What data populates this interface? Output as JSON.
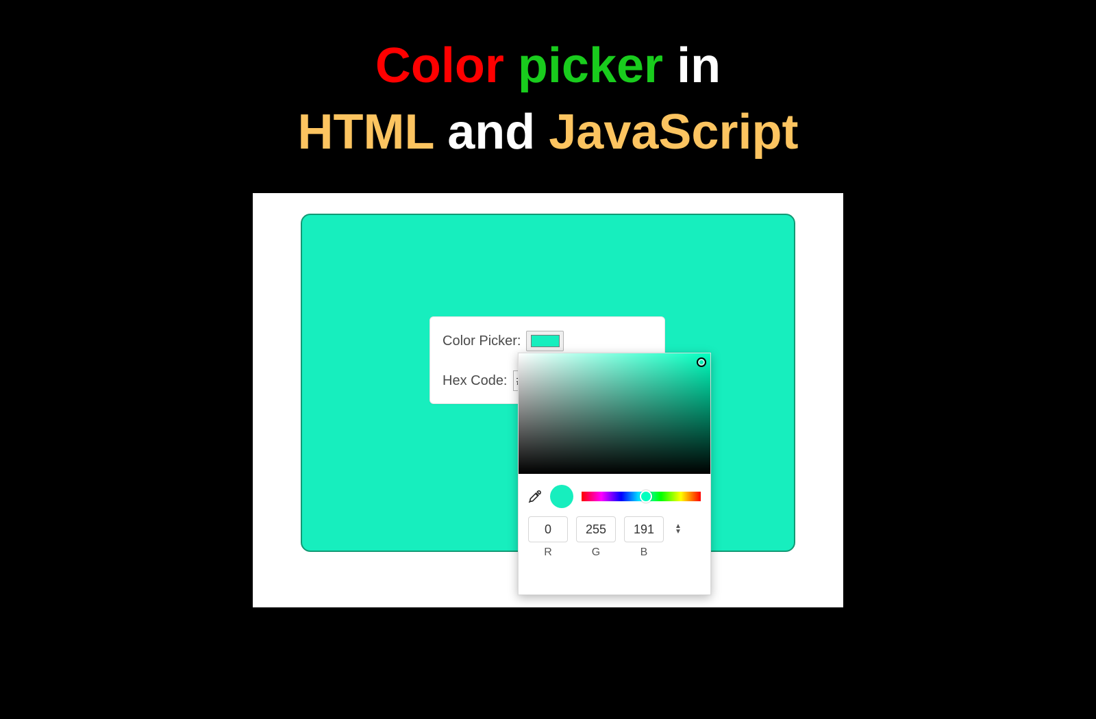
{
  "title": {
    "w1": "Color",
    "w2": "picker",
    "w3": "in",
    "w4": "HTML",
    "w5": "and",
    "w6": "JavaScript"
  },
  "card": {
    "picker_label": "Color Picker:",
    "hex_label": "Hex Code:",
    "hex_value": "#0"
  },
  "picker": {
    "selected_hex": "#17eebe",
    "hue_deg": 165,
    "hue_cursor_left_pct": 54,
    "rgb": {
      "r": "0",
      "g": "255",
      "b": "191"
    },
    "labels": {
      "r": "R",
      "g": "G",
      "b": "B"
    }
  },
  "colors": {
    "red": "#ff0000",
    "green": "#19cc1d",
    "white": "#ffffff",
    "amber": "#fcc460",
    "swatch": "#17eebe"
  }
}
